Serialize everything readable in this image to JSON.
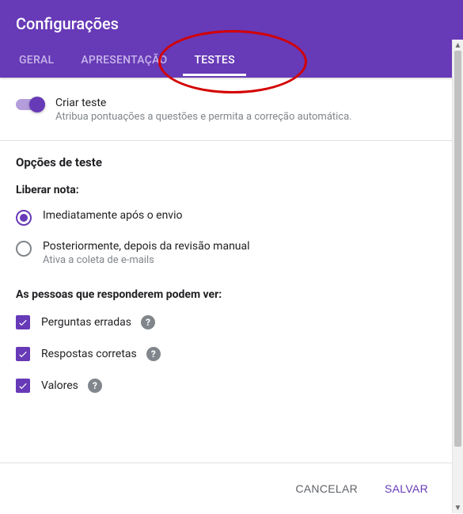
{
  "colors": {
    "accent": "#673ab7"
  },
  "header": {
    "title": "Configurações"
  },
  "tabs": [
    {
      "label": "GERAL",
      "active": false
    },
    {
      "label": "APRESENTAÇÃO",
      "active": false
    },
    {
      "label": "TESTES",
      "active": true
    }
  ],
  "toggle": {
    "on": true,
    "label": "Criar teste",
    "sub": "Atribua pontuações a questões e permita a correção automática."
  },
  "options": {
    "title": "Opções de teste",
    "release_label": "Liberar nota:",
    "release_choices": [
      {
        "label": "Imediatamente após o envio",
        "sub": "",
        "checked": true
      },
      {
        "label": "Posteriormente, depois da revisão manual",
        "sub": "Ativa a coleta de e-mails",
        "checked": false
      }
    ],
    "see_label": "As pessoas que responderem podem ver:",
    "see_items": [
      {
        "label": "Perguntas erradas",
        "checked": true
      },
      {
        "label": "Respostas corretas",
        "checked": true
      },
      {
        "label": "Valores",
        "checked": true
      }
    ]
  },
  "footer": {
    "cancel": "CANCELAR",
    "save": "SALVAR"
  }
}
